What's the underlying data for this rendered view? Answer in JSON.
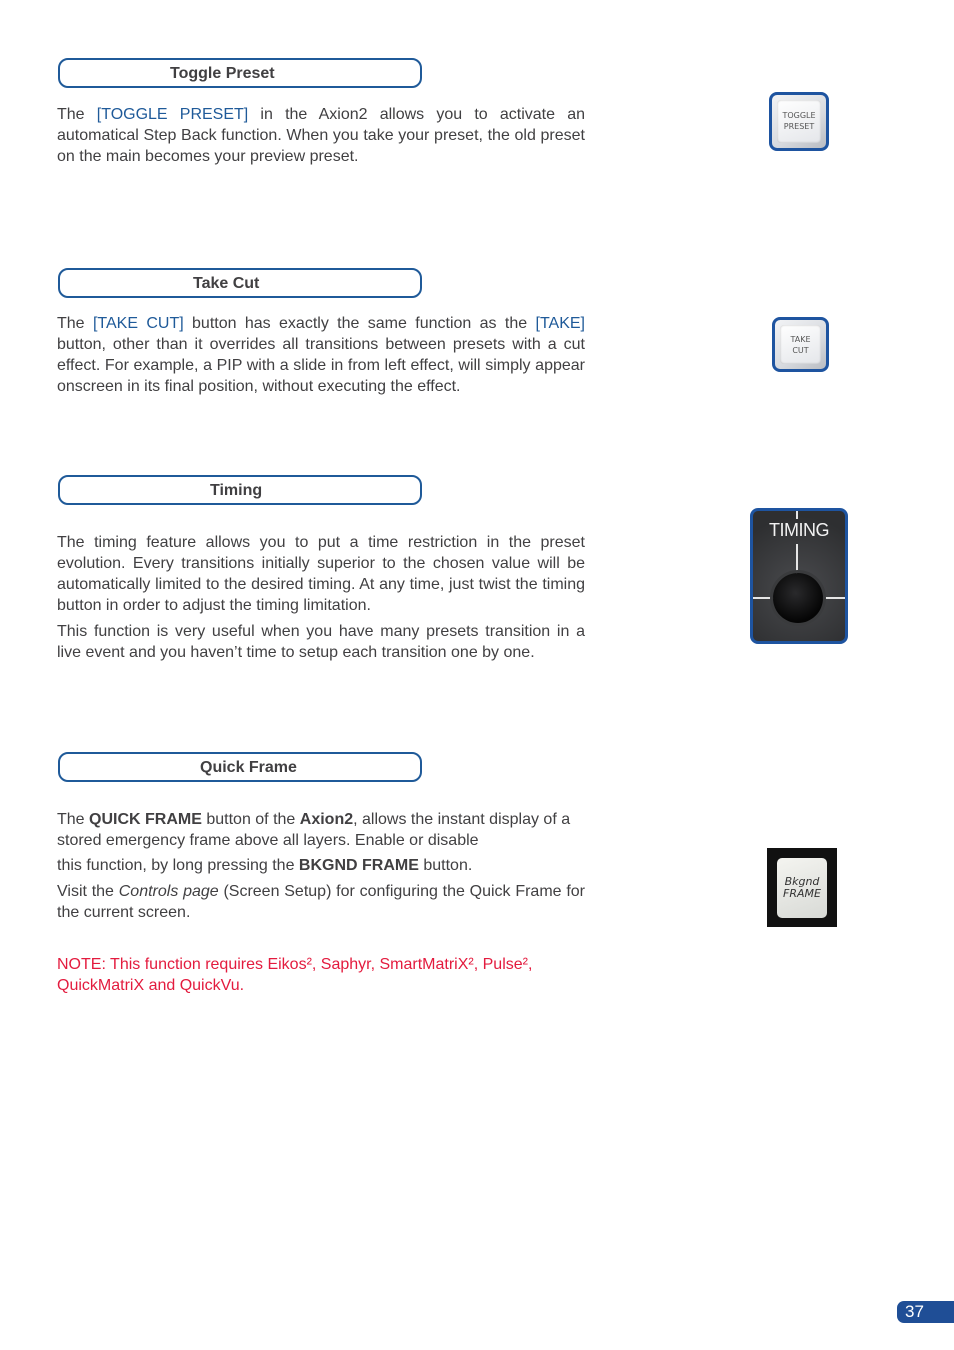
{
  "sections": [
    {
      "title": "Toggle Preset",
      "paragraphs": [
        {
          "pre": "The ",
          "hl": "[TOGGLE PRESET]",
          "post": " in the Axion2 allows you to activate an automatical Step Back function. When you take your preset, the old preset on the main becomes your preview preset."
        }
      ],
      "image": {
        "lines": [
          "TOGGLE",
          "PRESET"
        ]
      }
    },
    {
      "title": "Take Cut",
      "paragraphs": [
        {
          "pre": "The ",
          "hl": "[TAKE CUT]",
          "mid": " button has exactly the same function as the ",
          "hl2": "[TAKE]",
          "post": " button, other than it overrides all transitions between presets with a cut effect. For example, a PIP with a slide in from left effect, will simply appear onscreen in its final position, without executing the effect."
        }
      ],
      "image": {
        "lines": [
          "TAKE",
          "CUT"
        ]
      }
    },
    {
      "title": "Timing",
      "paragraphs": [
        "The timing feature allows you to put a time restriction in the preset evolution. Every transitions initially superior to the chosen value will be automatically limited to the desired timing. At any time, just twist the timing button in order to adjust the timing limitation.",
        "This function is very useful when you have many presets transition in a live event and you haven’t time to setup each transition one by one."
      ],
      "image": {
        "label": "TIMING"
      }
    },
    {
      "title": "Quick Frame",
      "p1": {
        "a": "The ",
        "b1": "QUICK FRAME",
        "c": " button of the ",
        "b2": "Axion2",
        "d": ", allows the instant display of a stored emergency frame above all layers. Enable or disable"
      },
      "p2": {
        "a": "this function, by long pressing the ",
        "b": "BKGND FRAME",
        "c": " button."
      },
      "p3": {
        "a": "Visit the ",
        "i": "Controls page",
        "b": " (Screen Setup) for configuring the Quick Frame for the current screen."
      },
      "note": "NOTE: This function requires Eikos², Saphyr, SmartMatriX², Pulse², QuickMatriX and QuickVu.",
      "image": {
        "lines": [
          "Bkgnd",
          "FRAME"
        ]
      }
    }
  ],
  "colors": {
    "accent_blue": "#1f5a99",
    "note_red": "#e31b3e",
    "page_badge": "#1f4e96"
  },
  "page_number": "37"
}
